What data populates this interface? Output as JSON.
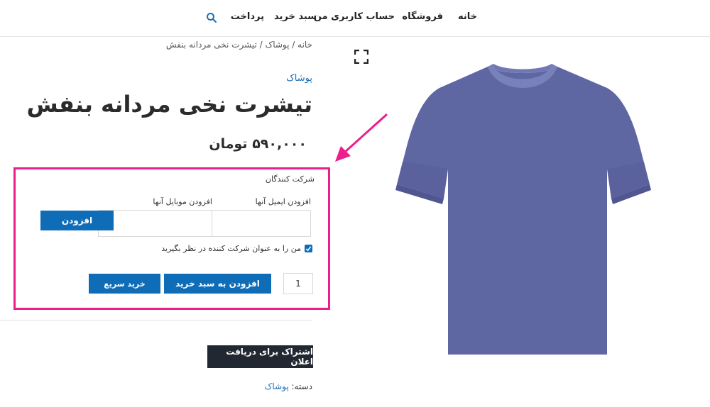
{
  "nav": {
    "home": "خانه",
    "shop": "فروشگاه",
    "account": "حساب کاربری من",
    "cart": "سبد خرید",
    "checkout": "پرداخت"
  },
  "icons": {
    "search": "search-icon",
    "zoom": "fullscreen-icon"
  },
  "breadcrumb": {
    "home": "خانه",
    "sep1": " / ",
    "category": "پوشاک",
    "sep2": " / ",
    "current": "تیشرت نخی مردانه بنفش"
  },
  "product": {
    "category_tag": "پوشاک",
    "title": "تیشرت نخی مردانه بنفش",
    "price": "۵۹۰,۰۰۰ تومان",
    "image_color": "#5f67a3"
  },
  "participants": {
    "heading": "شرکت کنندگان",
    "email_label": "افزودن ایمیل آنها",
    "mobile_label": "افزودن موبایل آنها",
    "email_value": "",
    "mobile_value": "",
    "add_button": "افزودن",
    "self_checkbox_label": "من را به عنوان شرکت کننده در نظر بگیرید",
    "self_checked": true
  },
  "purchase": {
    "quantity": "1",
    "add_to_cart": "افزودن به سبد خرید",
    "buy_now": "خرید سریع"
  },
  "subscribe_button": "اشتراک برای دریافت اعلان",
  "meta": {
    "category_key": "دسته:",
    "category_value": "پوشاک"
  },
  "colors": {
    "accent": "#0f6db8",
    "annotation": "#ec1e8c",
    "dark_button": "#222831",
    "link": "#1f6fb7"
  }
}
